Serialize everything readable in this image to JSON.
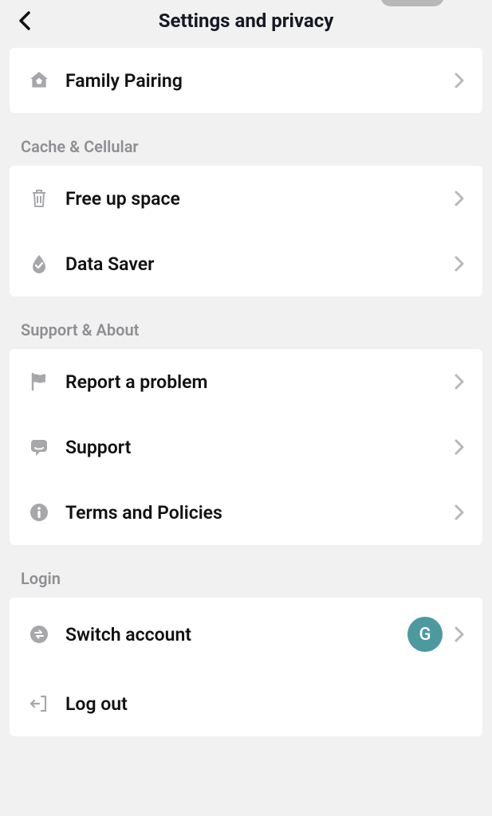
{
  "header": {
    "title": "Settings and privacy"
  },
  "sections": {
    "family": {
      "items": {
        "family_pairing": "Family Pairing"
      }
    },
    "cache": {
      "label": "Cache & Cellular",
      "items": {
        "free_up_space": "Free up space",
        "data_saver": "Data Saver"
      }
    },
    "support": {
      "label": "Support & About",
      "items": {
        "report_problem": "Report a problem",
        "support": "Support",
        "terms": "Terms and Policies"
      }
    },
    "login": {
      "label": "Login",
      "items": {
        "switch_account": "Switch account",
        "log_out": "Log out"
      },
      "avatar_initial": "G"
    }
  }
}
